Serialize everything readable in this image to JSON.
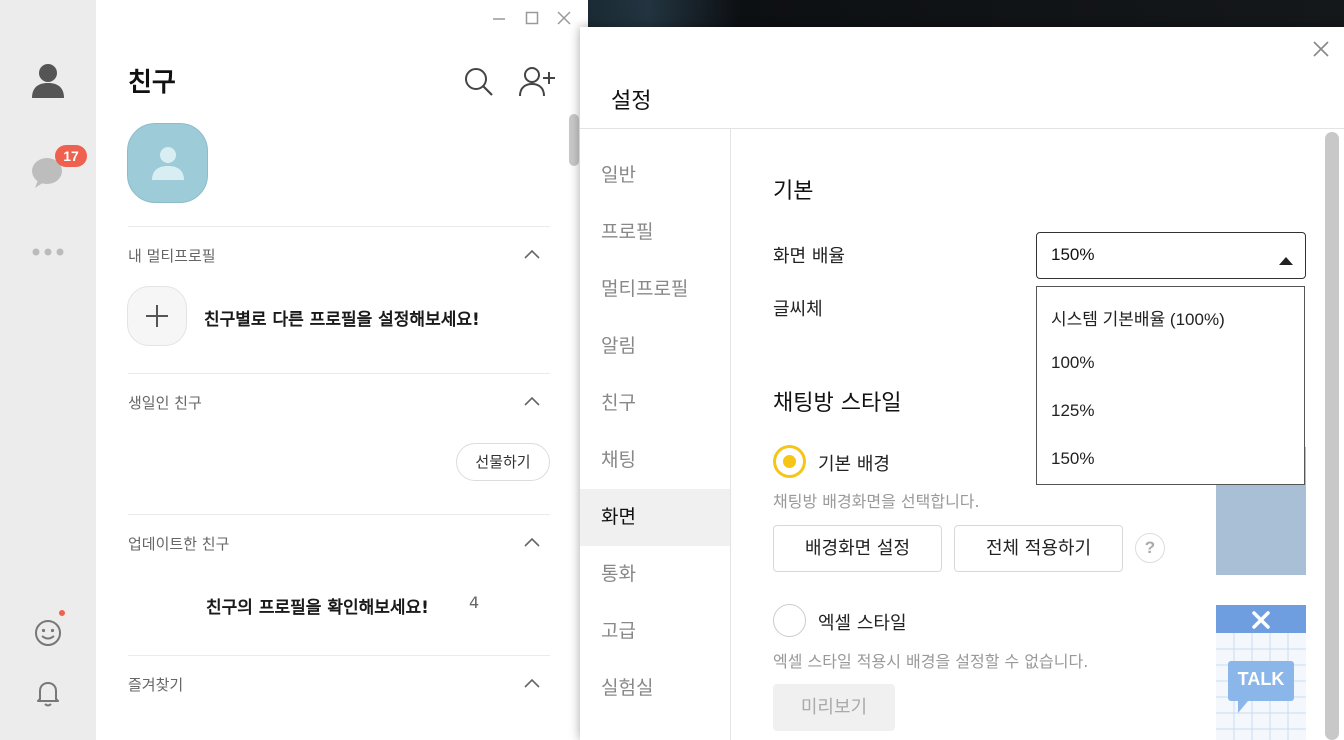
{
  "rail": {
    "chat_badge": "17"
  },
  "friends": {
    "title": "친구",
    "sections": {
      "multiprofile": {
        "label": "내 멀티프로필",
        "cta": "친구별로 다른 프로필을 설정해보세요!"
      },
      "birthday": {
        "label": "생일인 친구",
        "gift_button": "선물하기"
      },
      "updated": {
        "label": "업데이트한 친구",
        "cta": "친구의 프로필을 확인해보세요!",
        "count": "4"
      },
      "favorites": {
        "label": "즐겨찾기"
      }
    }
  },
  "settings": {
    "title": "설정",
    "nav": [
      {
        "label": "일반"
      },
      {
        "label": "프로필"
      },
      {
        "label": "멀티프로필"
      },
      {
        "label": "알림"
      },
      {
        "label": "친구"
      },
      {
        "label": "채팅"
      },
      {
        "label": "화면",
        "active": true
      },
      {
        "label": "통화"
      },
      {
        "label": "고급"
      },
      {
        "label": "실험실"
      }
    ],
    "basic": {
      "heading": "기본",
      "zoom_label": "화면 배율",
      "zoom_value": "150%",
      "font_label": "글씨체",
      "zoom_options": [
        "시스템 기본배율 (100%)",
        "100%",
        "125%",
        "150%"
      ]
    },
    "chat_style": {
      "heading": "채팅방 스타일",
      "basic_bg": {
        "label": "기본 배경",
        "selected": true,
        "desc": "채팅방 배경화면을 선택합니다.",
        "set_bg_button": "배경화면 설정",
        "apply_all_button": "전체 적용하기",
        "help": "?"
      },
      "excel": {
        "label": "엑셀 스타일",
        "selected": false,
        "desc": "엑셀 스타일 적용시 배경을 설정할 수 없습니다.",
        "preview_button": "미리보기",
        "thumb_text": "TALK"
      }
    }
  },
  "colors": {
    "accent_yellow": "#f5c518",
    "badge_red": "#f0604e",
    "avatar_teal": "#9dcbd8"
  }
}
